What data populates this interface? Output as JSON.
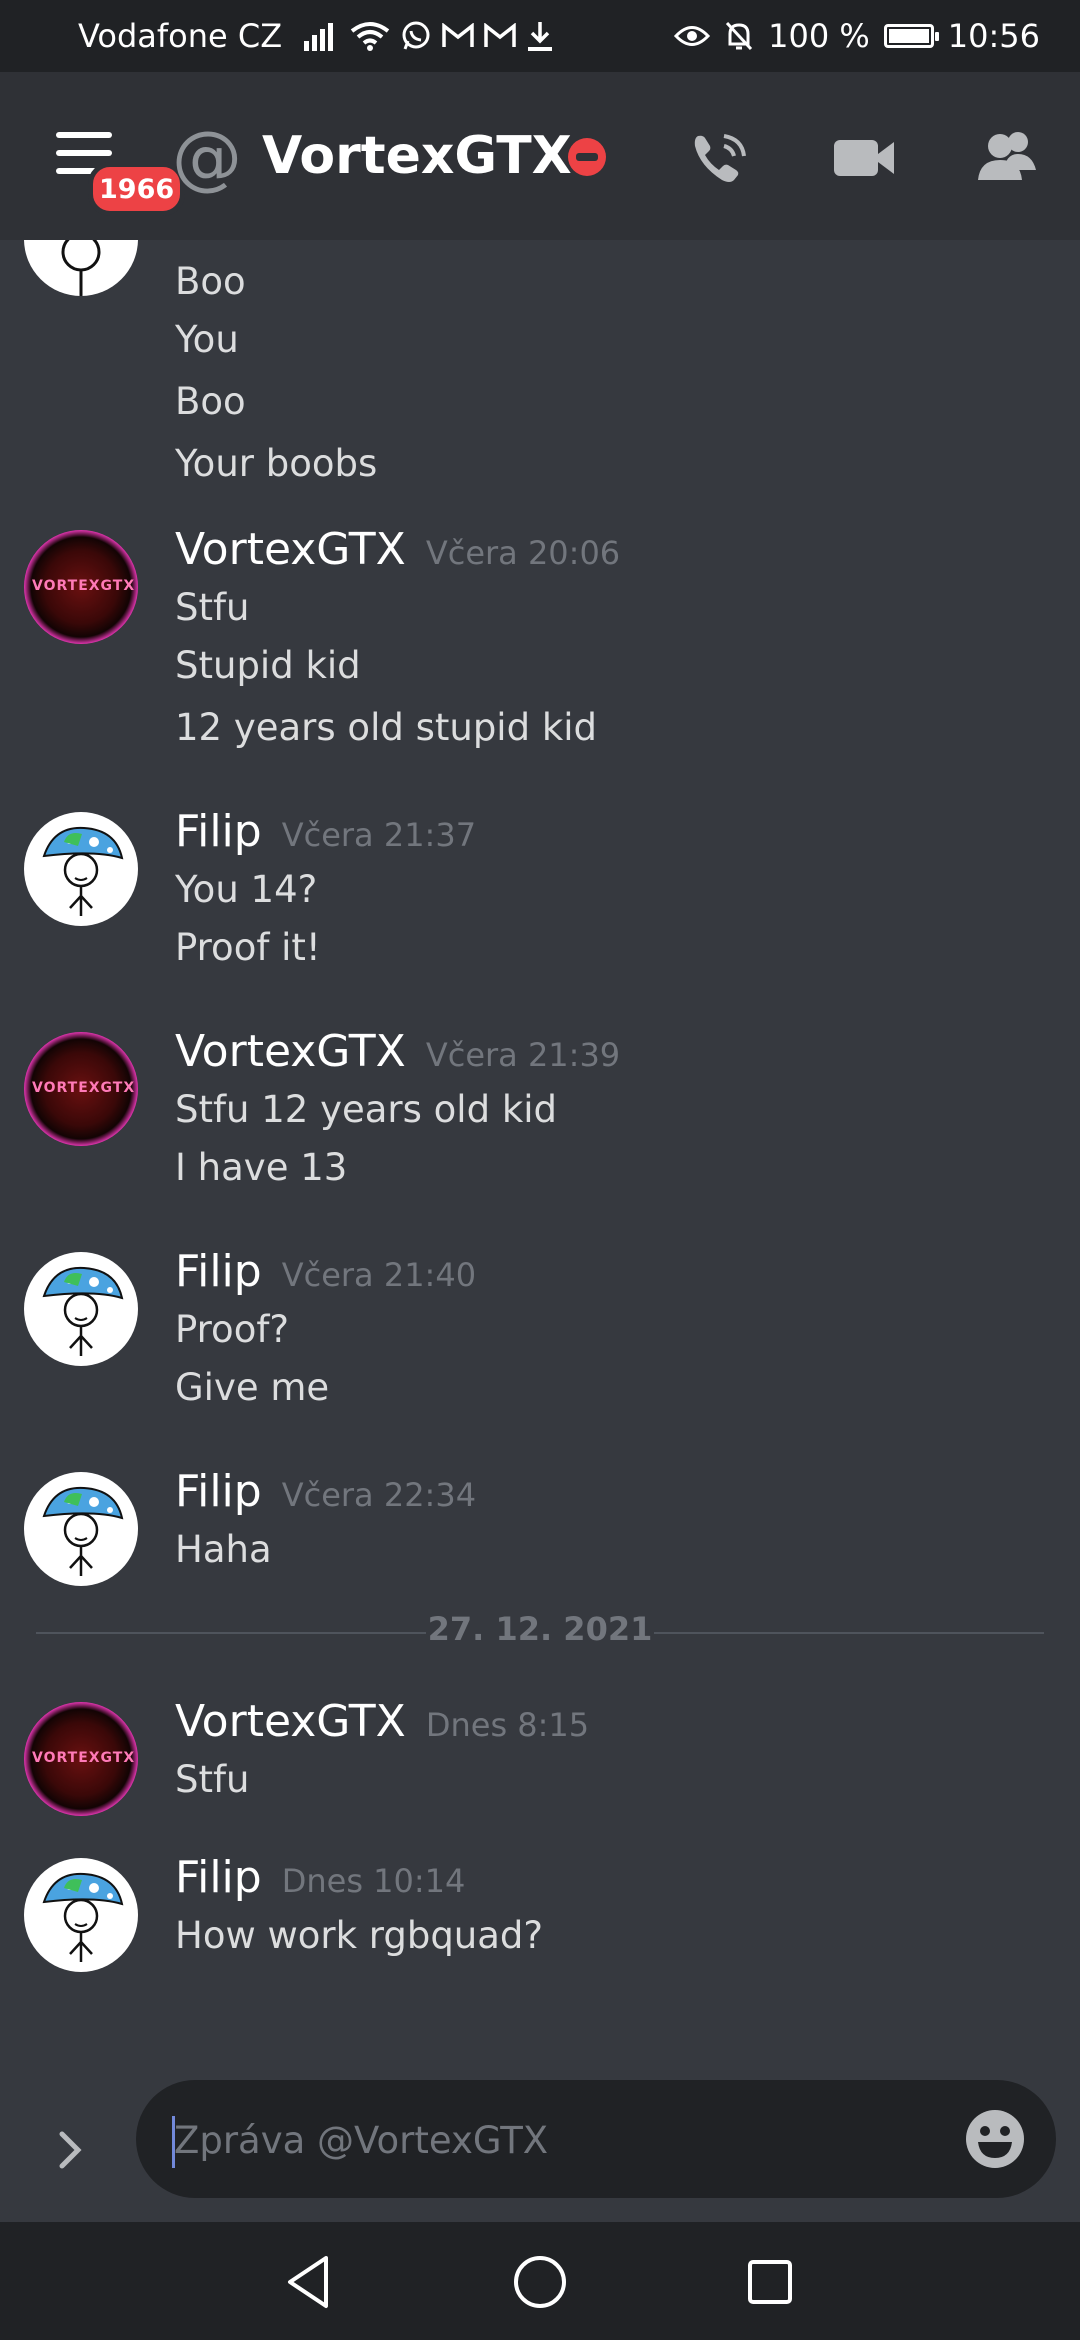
{
  "status_bar": {
    "carrier": "Vodafone CZ",
    "battery": "100 %",
    "time": "10:56",
    "icons": [
      "signal-icon",
      "wifi-icon",
      "whatsapp-icon",
      "gmail-icon",
      "gmail-icon",
      "download-icon",
      "eye-icon",
      "bell-off-icon",
      "battery-icon"
    ]
  },
  "header": {
    "badge_count": "1966",
    "title": "VortexGTX",
    "status": "do-not-disturb",
    "buttons": [
      "call-icon",
      "video-icon",
      "members-icon"
    ]
  },
  "messages": [
    {
      "partial": true,
      "lines": [
        "Boo",
        "You",
        "Boo",
        "Your boobs"
      ]
    },
    {
      "author": "VortexGTX",
      "time": "Včera 20:06",
      "lines": [
        "Stfu",
        "Stupid kid",
        "12 years old stupid kid"
      ]
    },
    {
      "author": "Filip",
      "time": "Včera 21:37",
      "lines": [
        "You 14?",
        "Proof it!"
      ]
    },
    {
      "author": "VortexGTX",
      "time": "Včera 21:39",
      "lines": [
        "Stfu 12 years old kid",
        "I have 13"
      ]
    },
    {
      "author": "Filip",
      "time": "Včera 21:40",
      "lines": [
        "Proof?",
        "Give me"
      ]
    },
    {
      "author": "Filip",
      "time": "Včera 22:34",
      "lines": [
        "Haha"
      ]
    },
    {
      "author": "VortexGTX",
      "time": "Dnes 8:15",
      "lines": [
        "Stfu"
      ]
    },
    {
      "author": "Filip",
      "time": "Dnes 10:14",
      "lines": [
        "How work rgbquad?"
      ]
    }
  ],
  "date_divider": "27. 12. 2021",
  "avatar_text": "VORTEXGTX",
  "composer": {
    "placeholder": "Zpráva @VortexGTX"
  },
  "colors": {
    "background": "#36393f",
    "header": "#2f3136",
    "input": "#202225",
    "badge": "#ed4245",
    "accent": "#7289da"
  }
}
